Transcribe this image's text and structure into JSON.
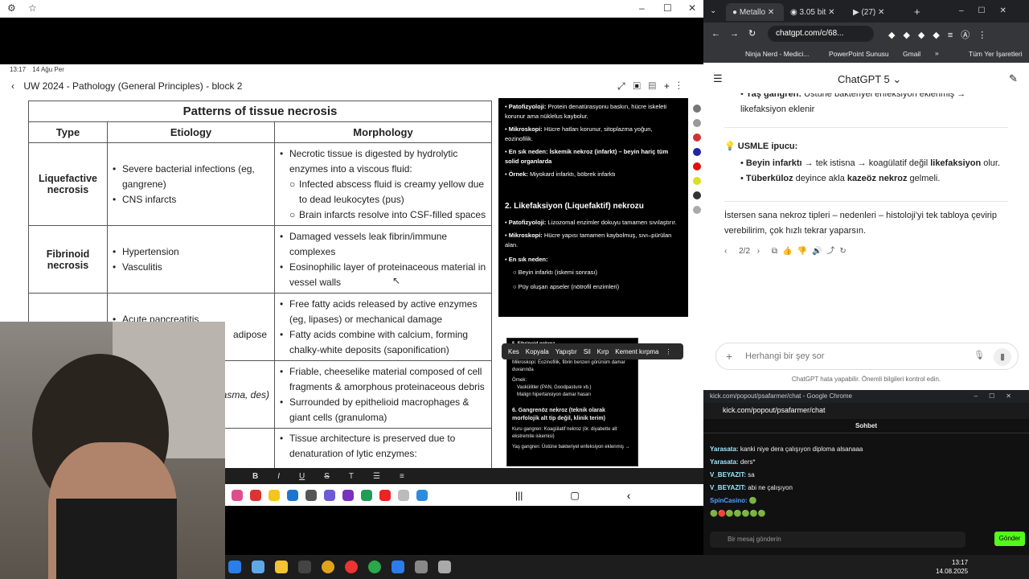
{
  "doc": {
    "status_time": "13:17",
    "status_date": "14 Ağu Per",
    "title": "UW 2024 - Pathology (General Principles) - block 2",
    "table_title": "Patterns of tissue necrosis",
    "headers": [
      "Type",
      "Etiology",
      "Morphology"
    ],
    "rows": [
      {
        "type": "Liquefactive necrosis",
        "etiology": [
          "Severe bacterial infections (eg, gangrene)",
          "CNS infarcts"
        ],
        "morphology": [
          "Necrotic tissue is digested by hydrolytic enzymes into a viscous fluid:"
        ],
        "sub": [
          "Infected abscess fluid is creamy yellow due to dead leukocytes (pus)",
          "Brain infarcts resolve into CSF-filled spaces"
        ]
      },
      {
        "type": "Fibrinoid necrosis",
        "etiology": [
          "Hypertension",
          "Vasculitis"
        ],
        "morphology": [
          "Damaged vessels leak fibrin/immune complexes",
          "Eosinophilic layer of proteinaceous material in vessel walls"
        ],
        "sub": []
      },
      {
        "type": "",
        "etiology": [
          "Acute pancreatitis",
          "adipose"
        ],
        "morphology": [
          "Free fatty acids released by active enzymes (eg, lipases) or mechanical damage",
          "Fatty acids combine with calcium, forming chalky-white deposits (saponification)"
        ],
        "sub": []
      },
      {
        "type": "stoplasma, des)",
        "etiology": [],
        "morphology": [
          "Friable, cheeselike material composed of cell fragments & amorphous proteinaceous debris",
          "Surrounded by epithelioid macrophages & giant cells (granuloma)"
        ],
        "sub": []
      },
      {
        "type": "",
        "etiology": [],
        "morphology": [
          "Tissue architecture is preserved due to denaturation of lytic enzymes:"
        ],
        "sub": []
      }
    ]
  },
  "notes": {
    "l1_b": "Patofizyoloji:",
    "l1": "Protein denatürasyonu baskın, hücre iskeleti korunur ama nüklelus kaybolur.",
    "l2_b": "Mikroskopi:",
    "l2": "Hücre hatları korunur, sitoplazma yoğun, eozinofilik.",
    "l3_b": "En sık neden:",
    "l3": "İskemik nekroz (infarkt) – beyin hariç tüm solid organlarda",
    "l4_b": "Örnek:",
    "l4": "Miyokard infarktı, böbrek infarktı",
    "heading": "2. Likefaksiyon (Liquefaktif) nekrozu",
    "l5_b": "Patofizyoloji:",
    "l5": "Lizozomal enzimler dokuyu tamamen sıvılaştırır.",
    "l6_b": "Mikroskopi:",
    "l6": "Hücre yapısı tamamen kaybolmuş, sıvı–pürülan alan.",
    "l7_b": "En sık neden:",
    "l8": "Beyin infarktı (iskemi sonrası)",
    "l9": "Püy oluşan apseler (nötrofil enzimleri)"
  },
  "card2": {
    "l1": "5. Fibrinoid nekroz",
    "l2": "Mikroskopi: Eozinofilik, fibrin benzeri görünüm damar duvarında",
    "l3": "Örnek:",
    "l4": "Vaskülitler (PAN, Goodpasture vb.)",
    "l5": "Malign hipertansiyon damar hasarı",
    "l6": "6. Gangrenöz nekroz (teknik olarak morfolojik alt tip değil, klinik terim)",
    "l7": "Kuru gangren: Koagülatif nekroz (ör. diyabette alt ekstremite iskemisi)",
    "l8": "Yaş gangren: Üstüne bakteriyel enfeksiyon eklenmiş →"
  },
  "context_menu": [
    "Kes",
    "Kopyala",
    "Yapıştır",
    "Sil",
    "Kırp",
    "Kement kırpma"
  ],
  "format_bar": [
    "B",
    "I",
    "U",
    "S",
    "T"
  ],
  "chrome": {
    "tab1": "Metallo",
    "tab2": "3.05 bit",
    "tab3": "(27)",
    "url": "chatgpt.com/c/68...",
    "bookmarks": [
      "Ninja Nerd - Medici...",
      "PowerPoint Sunusu",
      "Gmail",
      "»",
      "Tüm Yer İşaretleri"
    ],
    "model": "ChatGPT 5",
    "line1_b": "Yaş gangren:",
    "line1": "Üstüne bakteriyel enfeksiyon eklenmiş → likefaksiyon eklenir",
    "tip_title": "USMLE ipucu:",
    "tip1_b": "Beyin infarktı",
    "tip1": "→ tek istisna → koagülatif değil",
    "tip1_c": "likefaksiyon",
    "tip1_d": "olur.",
    "tip2_b": "Tüberküloz",
    "tip2": "deyince akla",
    "tip2_c": "kazeöz nekroz",
    "tip2_d": "gelmeli.",
    "offer": "İstersen sana nekroz tipleri – nedenleri – histoloji'yi tek tabloya çevirip verebilirim, çok hızlı tekrar yaparsın.",
    "pager": "2/2",
    "input_placeholder": "Herhangi bir şey sor",
    "disclaimer": "ChatGPT hata yapabilir. Önemli bilgileri kontrol edin."
  },
  "kick": {
    "window_title": "kick.com/popout/psafarmer/chat - Google Chrome",
    "url": "kick.com/popout/psafarmer/chat",
    "tab": "Sohbet",
    "messages": [
      {
        "user": "Yarasata:",
        "text": "kanki niye dera çalışıyon diploma alsanaaa"
      },
      {
        "user": "Yarasata:",
        "text": "ders*"
      },
      {
        "user": "V_BEYAZIT:",
        "text": "sa"
      },
      {
        "user": "V_BEYAZIT:",
        "text": "abi ne çalışıyon"
      },
      {
        "user": "SpinCasino:",
        "text": ""
      }
    ],
    "input_placeholder": "Bir mesaj gönderin",
    "send": "Gönder"
  },
  "clock": {
    "time": "13:17",
    "date": "14.08.2025"
  }
}
